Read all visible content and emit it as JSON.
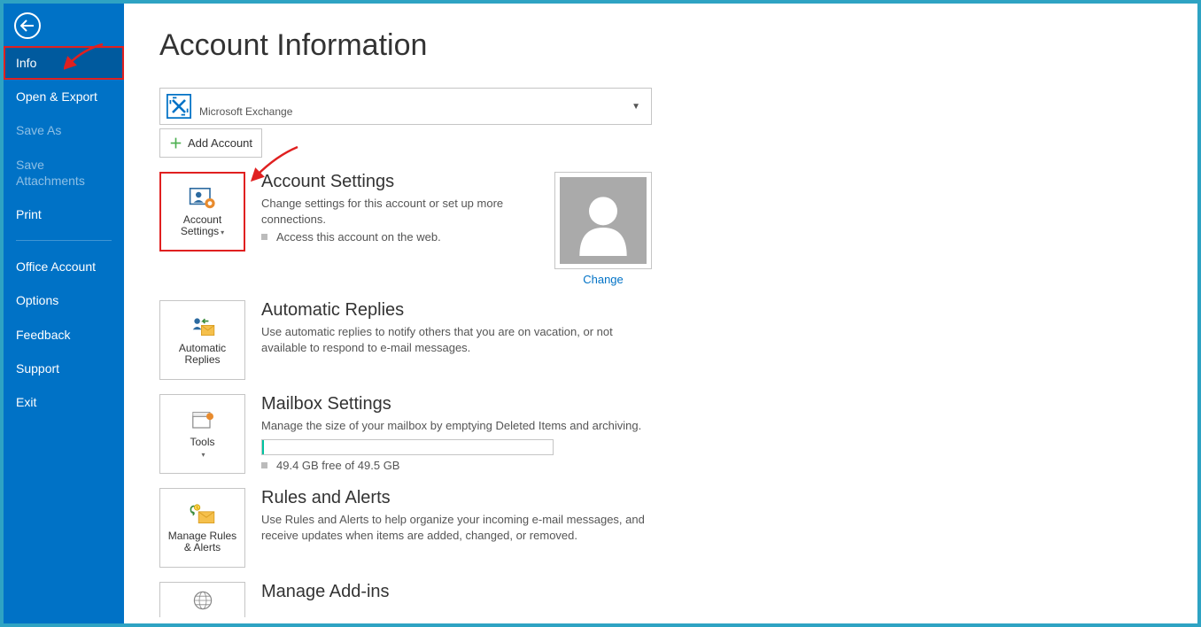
{
  "sidebar": {
    "items": [
      {
        "label": "Info",
        "selected": true
      },
      {
        "label": "Open & Export"
      },
      {
        "label": "Save As",
        "disabled": true
      },
      {
        "label": "Save Attachments",
        "disabled": true
      },
      {
        "label": "Print"
      }
    ],
    "items2": [
      {
        "label": "Office Account"
      },
      {
        "label": "Options"
      },
      {
        "label": "Feedback"
      },
      {
        "label": "Support"
      },
      {
        "label": "Exit"
      }
    ]
  },
  "page_title": "Account Information",
  "account_selector": {
    "account_type": "Microsoft Exchange"
  },
  "add_account_label": "Add Account",
  "sections": {
    "account_settings": {
      "tile_label": "Account Settings",
      "title": "Account Settings",
      "desc": "Change settings for this account or set up more connections.",
      "bullet": "Access this account on the web."
    },
    "avatar": {
      "change_label": "Change"
    },
    "auto_replies": {
      "tile_label": "Automatic Replies",
      "title": "Automatic Replies",
      "desc": "Use automatic replies to notify others that you are on vacation, or not available to respond to e-mail messages."
    },
    "mailbox": {
      "tile_label": "Tools",
      "title": "Mailbox Settings",
      "desc": "Manage the size of your mailbox by emptying Deleted Items and archiving.",
      "free_text": "49.4 GB free of 49.5 GB"
    },
    "rules": {
      "tile_label": "Manage Rules & Alerts",
      "title": "Rules and Alerts",
      "desc": "Use Rules and Alerts to help organize your incoming e-mail messages, and receive updates when items are added, changed, or removed."
    },
    "addins": {
      "title": "Manage Add-ins"
    }
  }
}
